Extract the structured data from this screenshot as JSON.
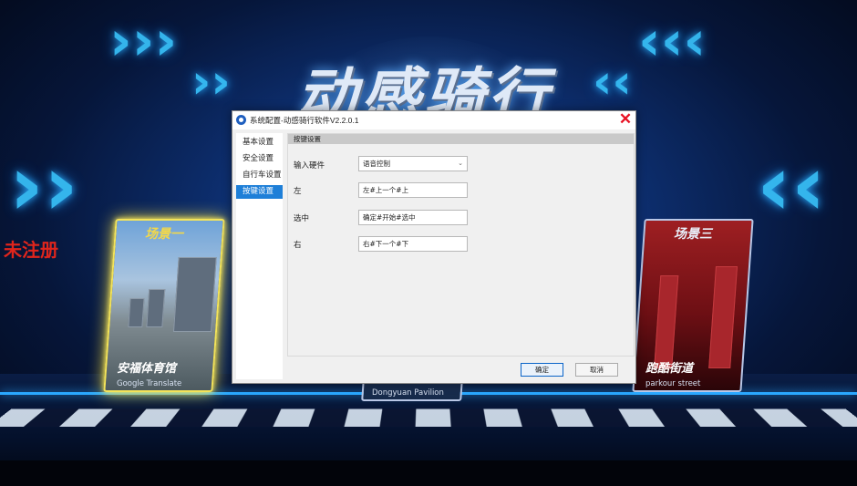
{
  "background": {
    "logo_text": "动感骑行",
    "unregistered": "未注册",
    "cards": [
      {
        "title": "场景一",
        "name": "安福体育馆",
        "subtitle": "Google Translate"
      },
      {
        "title": "",
        "name": "",
        "subtitle": "Dongyuan Pavilion"
      },
      {
        "title": "场景三",
        "name": "跑酷街道",
        "subtitle": "parkour street"
      }
    ]
  },
  "dialog": {
    "title": "系统配置-动感骑行软件V2.2.0.1",
    "close_glyph": "✕",
    "sidebar": {
      "items": [
        {
          "label": "基本设置",
          "active": false
        },
        {
          "label": "安全设置",
          "active": false
        },
        {
          "label": "自行车设置",
          "active": false
        },
        {
          "label": "按键设置",
          "active": true
        }
      ]
    },
    "section_header": "按键设置",
    "rows": [
      {
        "label": "输入硬件",
        "value": "语音控制",
        "type": "select"
      },
      {
        "label": "左",
        "value": "左#上一个#上",
        "type": "text"
      },
      {
        "label": "选中",
        "value": "确定#开始#选中",
        "type": "text"
      },
      {
        "label": "右",
        "value": "右#下一个#下",
        "type": "text"
      }
    ],
    "buttons": {
      "ok": "确定",
      "cancel": "取消"
    }
  },
  "colors": {
    "accent": "#1e7fd8",
    "close": "#e81123",
    "unregistered": "#e0251c"
  }
}
